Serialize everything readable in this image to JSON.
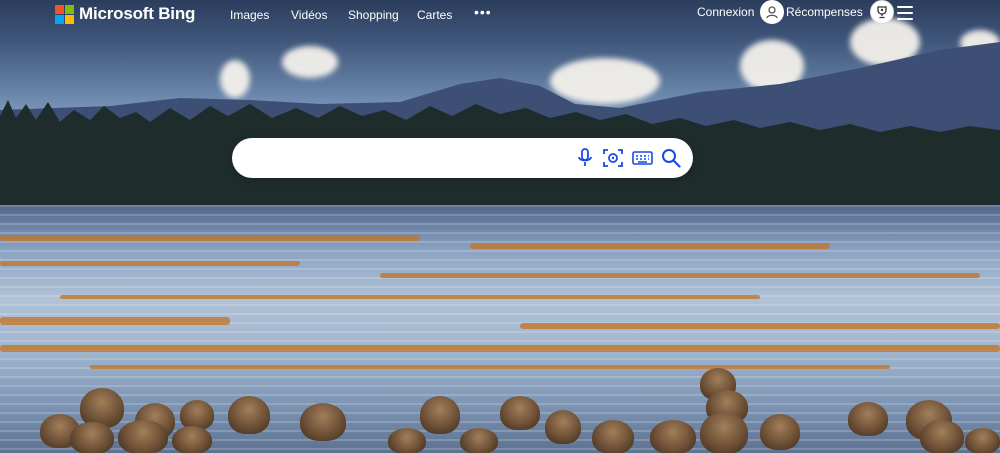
{
  "brand": {
    "name": "Microsoft Bing",
    "logo_colors": [
      "#f35325",
      "#81bc06",
      "#05a6f0",
      "#ffba08"
    ]
  },
  "nav": {
    "items": [
      {
        "label": "Images"
      },
      {
        "label": "Vidéos"
      },
      {
        "label": "Shopping"
      },
      {
        "label": "Cartes"
      }
    ],
    "more_label": "•••"
  },
  "account": {
    "signin_label": "Connexion",
    "rewards_label": "Récompenses",
    "avatar_icon": "user-icon",
    "rewards_icon": "trophy-icon",
    "menu_icon": "hamburger-menu-icon"
  },
  "search": {
    "value": "",
    "placeholder": "",
    "icons": [
      "microphone-icon",
      "visual-search-icon",
      "keyboard-icon",
      "search-icon"
    ],
    "accent": "#174ae4"
  }
}
